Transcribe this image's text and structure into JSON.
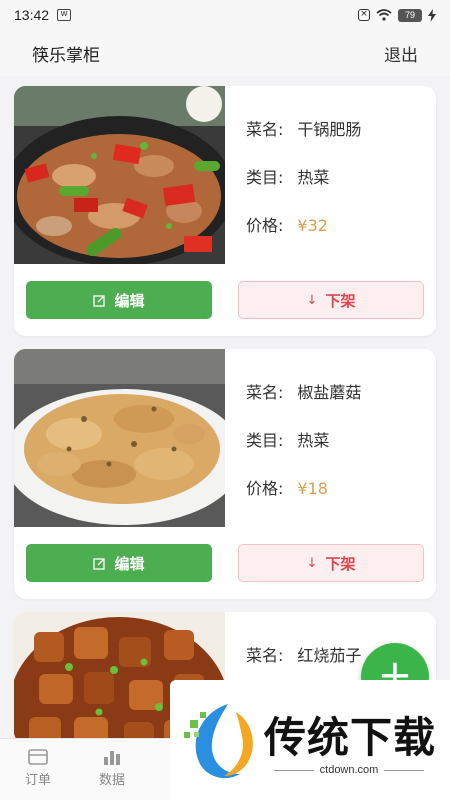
{
  "status_bar": {
    "time": "13:42",
    "battery": "79"
  },
  "header": {
    "title": "筷乐掌柜",
    "logout_label": "退出"
  },
  "labels": {
    "name": "菜名:",
    "category": "类目:",
    "price": "价格:"
  },
  "actions": {
    "edit_label": "编辑",
    "takedown_label": "下架"
  },
  "dishes": [
    {
      "name": "干锅肥肠",
      "category": "热菜",
      "price": "¥32"
    },
    {
      "name": "椒盐蘑菇",
      "category": "热菜",
      "price": "¥18"
    },
    {
      "name": "红烧茄子"
    }
  ],
  "fab": {
    "icon": "plus-icon"
  },
  "bottom_nav": [
    {
      "label": "订单",
      "icon": "order-card-icon"
    },
    {
      "label": "数据",
      "icon": "bar-chart-icon"
    }
  ],
  "watermark": {
    "title": "传统下载",
    "url": "ctdown.com"
  },
  "colors": {
    "edit": "#4cae50",
    "takedown": "#e0454f",
    "price": "#d9a050",
    "fab": "#3bb54a"
  }
}
